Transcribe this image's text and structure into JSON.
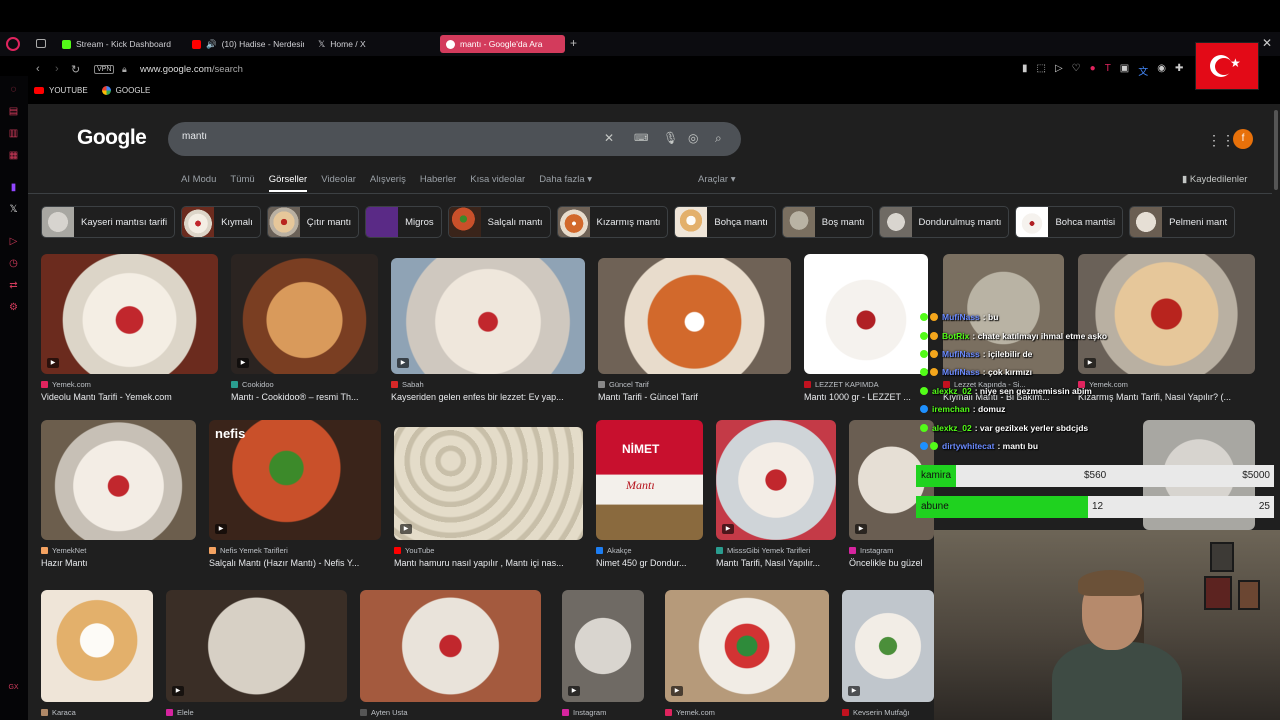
{
  "browser": {
    "tabs": [
      {
        "label": "Stream - Kick Dashboard",
        "color": "#53fc18"
      },
      {
        "label": "(10) Hadise - Nerdesin",
        "color": "#ff0000"
      },
      {
        "label": "Home / X",
        "color": "#ffffff"
      },
      {
        "label": "mantı - Google'da Ara",
        "color": "#4285f4"
      }
    ],
    "url_host": "www.google.com",
    "url_path": "/search",
    "vpn_label": "VPN",
    "bookmarks": [
      "YOUTUBE",
      "GOOGLE"
    ]
  },
  "google": {
    "logo": "Google",
    "query": "mantı",
    "avatar_letter": "f",
    "nav_tabs": [
      "AI Modu",
      "Tümü",
      "Görseller",
      "Videolar",
      "Alışveriş",
      "Haberler",
      "Kısa videolar",
      "Daha fazla ▾"
    ],
    "active_tab": "Görseller",
    "tools_label": "Araçlar ▾",
    "saved_label": "Kaydedilenler",
    "chips": [
      "Kayseri mantısı tarifi",
      "Kıymalı",
      "Çıtır mantı",
      "Migros",
      "Salçalı mantı",
      "Kızarmış mantı",
      "Bohça mantı",
      "Boş mantı",
      "Dondurulmuş mantı",
      "Bohca mantisi",
      "Pelmeni mant"
    ],
    "results_row1": [
      {
        "source": "Yemek.com",
        "title": "Videolu Mantı Tarifi - Yemek.com",
        "source_color": "#e0245e"
      },
      {
        "source": "Cookidoo",
        "title": "Mantı - Cookidoo® – resmi Th...",
        "source_color": "#2a9d8f"
      },
      {
        "source": "Sabah",
        "title": "Kayseriden gelen enfes bir lezzet: Ev yap...",
        "source_color": "#d62828"
      },
      {
        "source": "Güncel Tarif",
        "title": "Mantı Tarifi - Güncel Tarif",
        "source_color": "#888888"
      },
      {
        "source": "LEZZET KAPIMDA",
        "title": "Mantı 1000 gr - LEZZET ...",
        "source_color": "#c1121f"
      },
      {
        "source": "Lezzet Kapında - Si...",
        "title": "Kıymalı Mantı - Bi Bakım...",
        "source_color": "#c1121f"
      },
      {
        "source": "Yemek.com",
        "title": "Kızarmış Mantı Tarifi, Nasıl Yapılır? (...",
        "source_color": "#e0245e"
      }
    ],
    "results_row2": [
      {
        "source": "YemekNet",
        "title": "Hazır Mantı",
        "source_color": "#f4a261"
      },
      {
        "source": "Nefis Yemek Tarifleri",
        "title": "Salçalı Mantı (Hazır Mantı) - Nefis Y...",
        "source_color": "#f4a261"
      },
      {
        "source": "YouTube",
        "title": "Mantı hamuru nasıl yapılır , Mantı içi nas...",
        "source_color": "#ff0000"
      },
      {
        "source": "Akakçe",
        "title": "Nimet 450 gr Dondur...",
        "source_color": "#1d7df2"
      },
      {
        "source": "MisssGibi Yemek Tarifleri",
        "title": "Mantı Tarifi, Nasıl Yapılır...",
        "source_color": "#2a9d8f"
      },
      {
        "source": "Instagram",
        "title": "Öncelikle bu güzel",
        "source_color": "#d6249f"
      }
    ],
    "results_row3": [
      {
        "source": "Karaca"
      },
      {
        "source": "Elele"
      },
      {
        "source": "Ayten Usta"
      },
      {
        "source": "Instagram"
      },
      {
        "source": "Yemek.com"
      },
      {
        "source": "Kevserin Mutfağı"
      }
    ],
    "nimet_brand": "NİMET",
    "nimet_product": "Mantı",
    "nefis_brand": "nefis"
  },
  "stream": {
    "chat": [
      {
        "user": "MufiNass",
        "msg": "bu",
        "color": "#6b8bff"
      },
      {
        "user": "BotRix",
        "msg": "chate katılmayı ihmal etme aşko",
        "color": "#53fc18"
      },
      {
        "user": "MufiNass",
        "msg": "içilebilir de",
        "color": "#6b8bff"
      },
      {
        "user": "MufiNass",
        "msg": "çok kırmızı",
        "color": "#6b8bff"
      },
      {
        "user": "alexkz_02",
        "msg": "niye sen gezmemissin abim",
        "color": "#53fc18"
      },
      {
        "user": "iremchan",
        "msg": "domuz",
        "color": "#53fc18"
      },
      {
        "user": "alexkz_02",
        "msg": "var gezilxek yerler sbdcjds",
        "color": "#53fc18"
      },
      {
        "user": "dirtywhitecat",
        "msg": "mantı bu",
        "color": "#6b8bff"
      }
    ],
    "goals": [
      {
        "label": "kamira",
        "current": "$560",
        "max": "$5000",
        "fraction": 0.112
      },
      {
        "label": "abune",
        "current": "12",
        "max": "25",
        "fraction": 0.48
      }
    ]
  }
}
